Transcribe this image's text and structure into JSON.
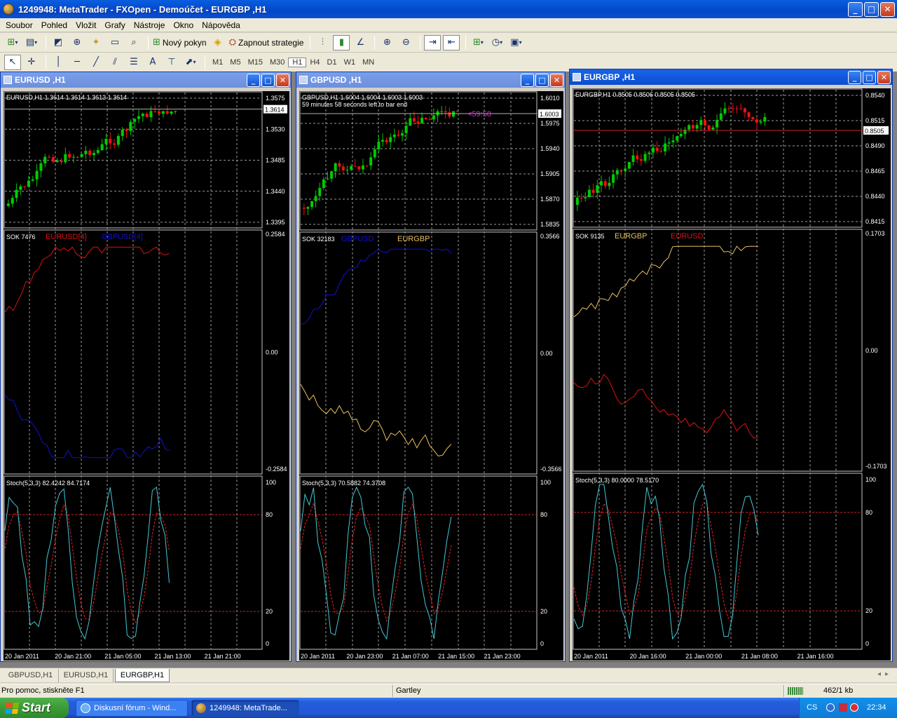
{
  "app": {
    "title": "1249948: MetaTrader - FXOpen - Demoúčet - EURGBP ,H1",
    "controls": {
      "minimize": "_",
      "maximize": "□",
      "close": "✕"
    }
  },
  "menu": [
    "Soubor",
    "Pohled",
    "Vložit",
    "Grafy",
    "Nástroje",
    "Okno",
    "Nápověda"
  ],
  "toolbar1": {
    "new_order_label": "Nový pokyn",
    "strategy_label": "Zapnout strategie"
  },
  "toolbar2": {
    "timeframes": [
      "M1",
      "M5",
      "M15",
      "M30",
      "H1",
      "H4",
      "D1",
      "W1",
      "MN"
    ],
    "selected_timeframe": "H1"
  },
  "windows": [
    {
      "id": "eurusd",
      "title": "EURUSD ,H1",
      "header": "EURUSD,H1  1.3614 1.3614 1.3613 1.3614",
      "price_ticks": [
        "1.3575",
        "1.3530",
        "1.3485",
        "1.3440",
        "1.3395"
      ],
      "current_price": "1.3614",
      "current_price_frac": 0.11,
      "sok_label": "SOK 7476",
      "sok_series": [
        {
          "name": "EURUSD[4]",
          "color": "#dd1111"
        },
        {
          "name": "GBPUSD[4]",
          "color": "#1111cc"
        }
      ],
      "sok_ticks": [
        "0.2584",
        "0.00",
        "-0.2584"
      ],
      "stoch_label": "Stoch(5,3,3) 82.4242 84.7174",
      "stoch_ticks": [
        "100",
        "80",
        "20",
        "0"
      ],
      "time_labels": [
        "20 Jan 2011",
        "20 Jan 21:00",
        "21 Jan 05:00",
        "21 Jan 13:00",
        "21 Jan 21:00"
      ]
    },
    {
      "id": "gbpusd",
      "title": "GBPUSD ,H1",
      "header": "GBPUSD,H1  1.6004 1.6004 1.6003 1.6003",
      "subheader": "59 minutes 58 seconds left to bar end",
      "countdown": "<59:58",
      "price_ticks": [
        "1.6010",
        "1.5975",
        "1.5940",
        "1.5905",
        "1.5870",
        "1.5835"
      ],
      "current_price": "1.6003",
      "current_price_frac": 0.14,
      "sok_label": "SOK 32183",
      "sok_series": [
        {
          "name": "GBPUSD",
          "color": "#1111cc"
        },
        {
          "name": "EURGBP",
          "color": "#e8c060"
        }
      ],
      "sok_ticks": [
        "0.3566",
        "0.00",
        "-0.3566"
      ],
      "stoch_label": "Stoch(5,3,3) 70.5882 74.3708",
      "stoch_ticks": [
        "100",
        "80",
        "20",
        "0"
      ],
      "time_labels": [
        "20 Jan 2011",
        "20 Jan 23:00",
        "21 Jan 07:00",
        "21 Jan 15:00",
        "21 Jan 23:00"
      ]
    },
    {
      "id": "eurgbp",
      "title": "EURGBP ,H1",
      "header": "EURGBP,H1  0.8505 0.8506 0.8505 0.8505",
      "price_ticks": [
        "0.8540",
        "0.8515",
        "0.8490",
        "0.8465",
        "0.8440",
        "0.8415"
      ],
      "current_price": "0.8505",
      "current_price_frac": 0.28,
      "sok_label": "SOK 9135",
      "sok_series": [
        {
          "name": "EURGBP",
          "color": "#e8c060"
        },
        {
          "name": "EURUSD",
          "color": "#dd1111"
        }
      ],
      "sok_ticks": [
        "0.1703",
        "0.00",
        "-0.1703"
      ],
      "stoch_label": "Stoch(5,3,3) 80.0000 78.5170",
      "stoch_ticks": [
        "100",
        "80",
        "20",
        "0"
      ],
      "time_labels": [
        "20 Jan 2011",
        "20 Jan 16:00",
        "21 Jan 00:00",
        "21 Jan 08:00",
        "21 Jan 16:00"
      ]
    }
  ],
  "tabs": [
    "GBPUSD,H1",
    "EURUSD,H1",
    "EURGBP,H1"
  ],
  "active_tab": "EURGBP,H1",
  "status": {
    "help": "Pro pomoc, stiskněte F1",
    "profile": "Gartley",
    "traffic": "462/1 kb"
  },
  "taskbar": {
    "start": "Start",
    "tasks": [
      "Diskusní fórum - Wind...",
      "1249948: MetaTrade..."
    ],
    "lang": "CS",
    "clock": "22:34"
  },
  "colors": {
    "candle_up": "#00cc00",
    "candle_down": "#ee1111",
    "stoch_main": "#45c7d4",
    "stoch_signal": "#ee2222",
    "grid": "#9a9a9a"
  }
}
